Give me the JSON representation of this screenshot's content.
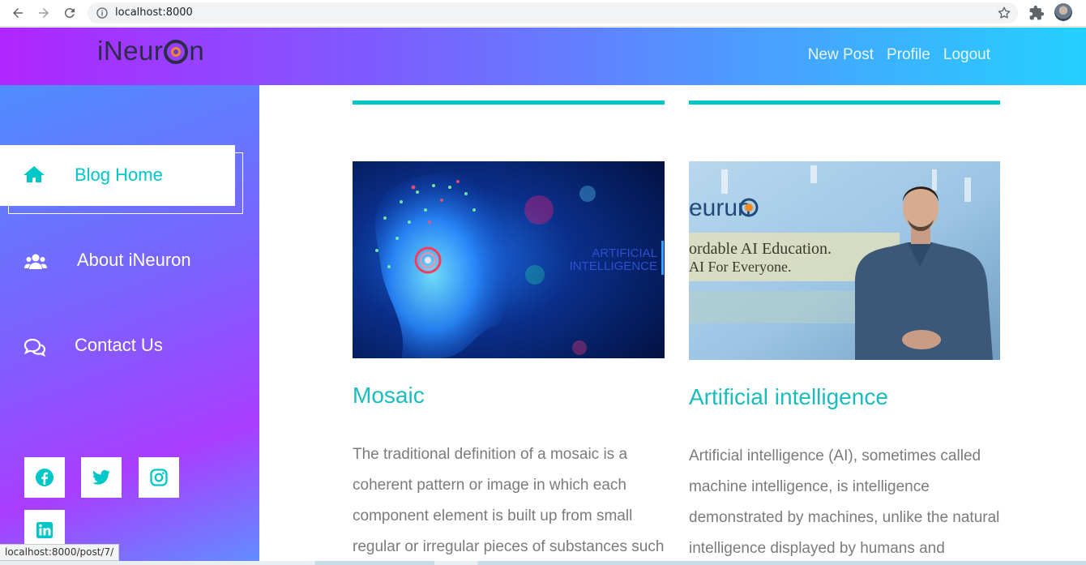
{
  "browser": {
    "url": "localhost:8000",
    "status_url": "localhost:8000/post/7/"
  },
  "header": {
    "logo_prefix": "iNeur",
    "logo_suffix": "n",
    "nav": [
      "New Post",
      "Profile",
      "Logout"
    ]
  },
  "sidebar": {
    "items": [
      {
        "label": "Blog Home",
        "icon": "home-icon"
      },
      {
        "label": "About iNeuron",
        "icon": "users-icon"
      },
      {
        "label": "Contact Us",
        "icon": "comments-icon"
      }
    ],
    "social": [
      "facebook-icon",
      "twitter-icon",
      "instagram-icon",
      "linkedin-icon"
    ]
  },
  "posts": [
    {
      "title": "Mosaic",
      "excerpt": "The traditional definition of a mosaic is a coherent pattern or image in which each component element is built up from small regular or irregular pieces of substances such",
      "image_text": "ARTIFICIAL\nINTELLIGENCE"
    },
    {
      "title": "Artificial intelligence",
      "excerpt": "Artificial intelligence (AI), sometimes called machine intelligence, is intelligence demonstrated by machines, unlike the natural intelligence displayed by humans and",
      "image_logo": "eurun",
      "image_line1": "ordable AI Education.",
      "image_line2": "AI For Everyone."
    }
  ],
  "colors": {
    "accent": "#00c7c7",
    "header_start": "#b025ff",
    "header_end": "#24d0ff"
  }
}
